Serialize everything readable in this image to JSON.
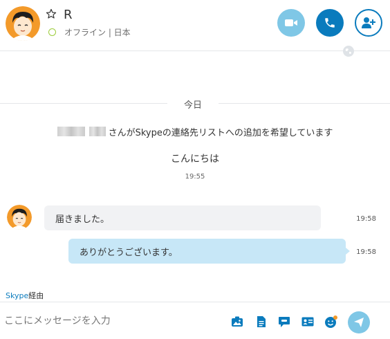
{
  "header": {
    "contact_name": "R",
    "status_text": "オフライン | 日本",
    "icons": {
      "favorite": "star-outline-icon",
      "video": "video-camera-icon",
      "call": "phone-icon",
      "add_people": "add-person-icon",
      "globe": "globe-icon"
    }
  },
  "conversation": {
    "date_label": "今日",
    "system_message": "さんがSkypeの連絡先リストへの追加を希望しています",
    "greeting": "こんにちは",
    "greeting_time": "19:55",
    "messages": [
      {
        "direction": "incoming",
        "text": "届きました。",
        "time": "19:58"
      },
      {
        "direction": "outgoing",
        "text": "ありがとうございます。",
        "time": "19:58"
      }
    ]
  },
  "via": {
    "brand": "Skype",
    "suffix": "経由"
  },
  "composer": {
    "placeholder": "ここにメッセージを入力",
    "tools": [
      "media-gallery-icon",
      "file-icon",
      "chat-bubble-icon",
      "contact-card-icon",
      "emoji-icon"
    ],
    "send_icon": "send-icon"
  },
  "colors": {
    "accent": "#0a7bbd",
    "accent_light": "#7fc7e6",
    "incoming_bubble": "#f1f2f4",
    "outgoing_bubble": "#c7e7f7",
    "status_offline": "#9ccc3a",
    "avatar_bg": "#f39a2a"
  }
}
